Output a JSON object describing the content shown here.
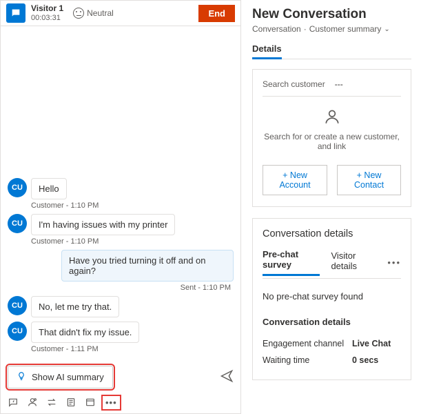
{
  "chat": {
    "visitor_name": "Visitor 1",
    "duration": "00:03:31",
    "sentiment": "Neutral",
    "end_label": "End",
    "avatar_initials": "CU",
    "messages": [
      {
        "dir": "in",
        "text": "Hello",
        "meta": "Customer - 1:10 PM"
      },
      {
        "dir": "in",
        "text": "I'm having issues with my printer",
        "meta": "Customer - 1:10 PM"
      },
      {
        "dir": "out",
        "text": "Have you tried turning it off and on again?",
        "meta": "Sent - 1:10 PM"
      },
      {
        "dir": "in",
        "text": "No, let me try that.",
        "meta": ""
      },
      {
        "dir": "in",
        "text": "That didn't fix my issue.",
        "meta": "Customer - 1:11 PM"
      }
    ],
    "ai_summary_label": "Show AI summary"
  },
  "side": {
    "title": "New Conversation",
    "breadcrumb_a": "Conversation",
    "breadcrumb_b": "Customer summary",
    "details_tab": "Details",
    "search_label": "Search customer",
    "search_value": "---",
    "search_hint": "Search for or create a new customer, and link",
    "new_account": "+ New Account",
    "new_contact": "+ New Contact",
    "conv_details_title": "Conversation details",
    "tab_prechat": "Pre-chat survey",
    "tab_visitor": "Visitor details",
    "prechat_empty": "No pre-chat survey found",
    "section_head": "Conversation details",
    "engagement_label": "Engagement channel",
    "engagement_value": "Live Chat",
    "waiting_label": "Waiting time",
    "waiting_value": "0 secs"
  }
}
